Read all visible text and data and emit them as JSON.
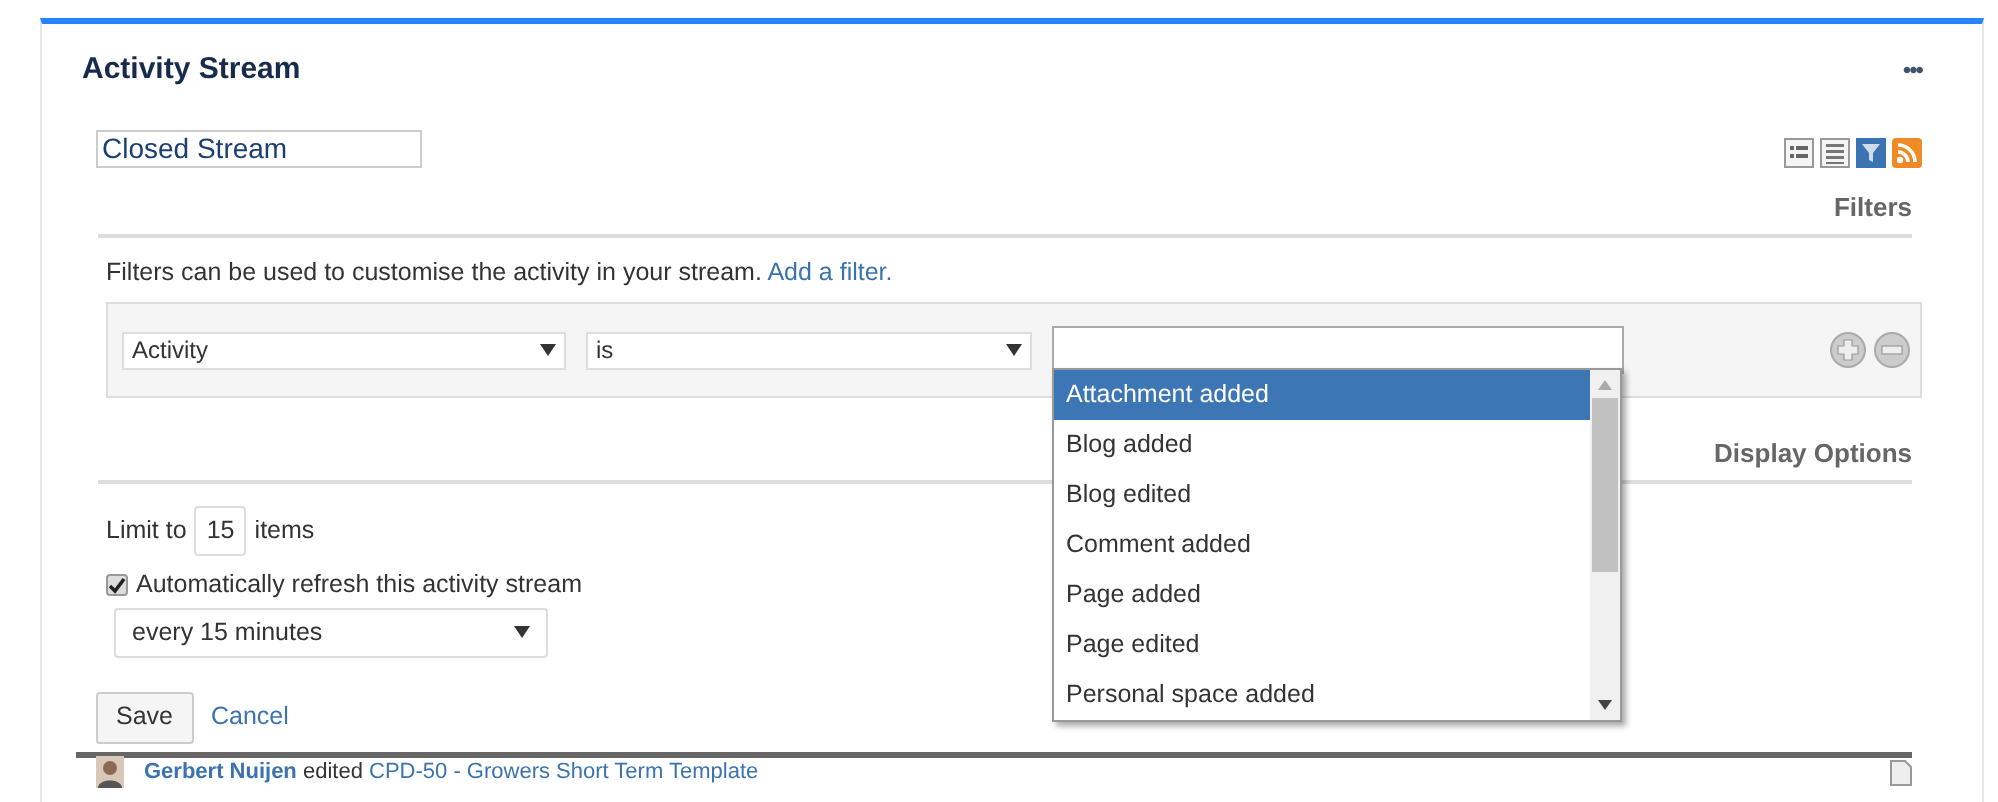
{
  "gadget": {
    "title": "Activity Stream",
    "menu": "•••"
  },
  "stream_name": {
    "value": "Closed Stream"
  },
  "filters": {
    "heading": "Filters",
    "intro": "Filters can be used to customise the activity in your stream.",
    "add_link": "Add a filter.",
    "rule": {
      "field": "Activity",
      "operator": "is"
    },
    "options": [
      {
        "label": "Attachment added",
        "selected": true
      },
      {
        "label": "Blog added",
        "selected": false
      },
      {
        "label": "Blog edited",
        "selected": false
      },
      {
        "label": "Comment added",
        "selected": false
      },
      {
        "label": "Page added",
        "selected": false
      },
      {
        "label": "Page edited",
        "selected": false
      },
      {
        "label": "Personal space added",
        "selected": false
      }
    ]
  },
  "display": {
    "heading": "Display Options",
    "limit_before": "Limit to",
    "limit": "15",
    "limit_after": "items",
    "refresh_label": "Automatically refresh this activity stream",
    "refresh_checked": true,
    "interval": "every 15 minutes"
  },
  "actions": {
    "save": "Save",
    "cancel": "Cancel"
  },
  "activity": {
    "user": "Gerbert Nuijen",
    "verb": "edited",
    "target": "CPD-50 - Growers Short Term Template"
  }
}
